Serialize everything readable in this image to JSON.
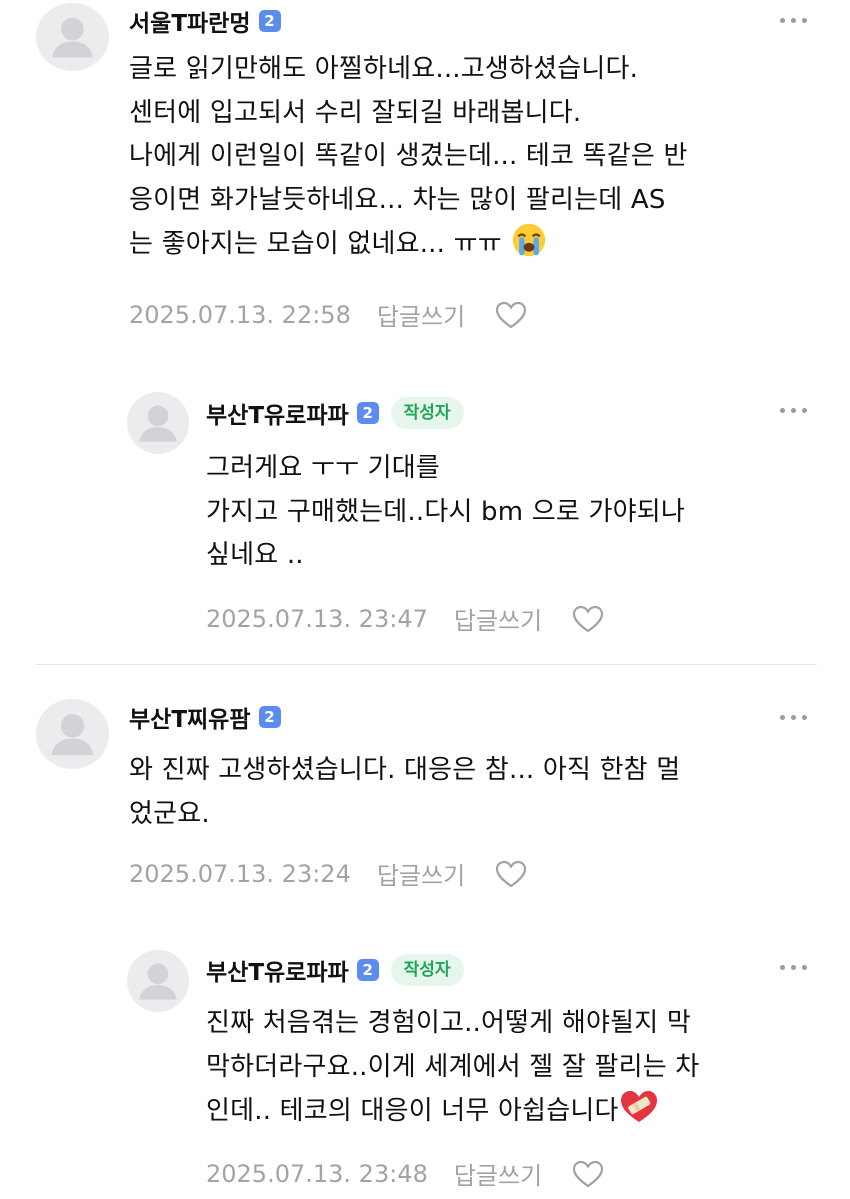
{
  "comments": [
    {
      "author": "서울T파란멍",
      "level": "2",
      "lines": [
        "글로 읽기만해도 아찔하네요...고생하셨습니다.",
        "센터에 입고되서 수리 잘되길 바래봅니다.",
        "나에게 이런일이 똑같이 생겼는데... 테코 똑같은 반",
        "응이면 화가날듯하네요... 차는 많이 팔리는데 AS",
        "는 좋아지는 모습이 없네요... ㅠㅠ "
      ],
      "emoji": "loudly-crying-face-emoji",
      "timestamp": "2025.07.13. 22:58",
      "reply_label": "답글쓰기"
    },
    {
      "author": "부산T유로파파",
      "level": "2",
      "badge": "작성자",
      "lines": [
        "그러게요 ㅜㅜ 기대를",
        "가지고 구매했는데..다시 bm 으로 가야되나",
        "싶네요 .."
      ],
      "timestamp": "2025.07.13. 23:47",
      "reply_label": "답글쓰기"
    },
    {
      "author": "부산T찌유팜",
      "level": "2",
      "lines": [
        "와 진짜 고생하셨습니다. 대응은 참... 아직 한참 멀",
        "었군요."
      ],
      "timestamp": "2025.07.13. 23:24",
      "reply_label": "답글쓰기"
    },
    {
      "author": "부산T유로파파",
      "level": "2",
      "badge": "작성자",
      "lines": [
        "진짜 처음겪는 경험이고..어떻게 해야될지 막",
        "막하더라구요..이게 세계에서 젤 잘 팔리는 차",
        "인데.. 테코의 대응이 너무 아쉽습니다"
      ],
      "emoji": "mending-heart-emoji",
      "timestamp": "2025.07.13. 23:48",
      "reply_label": "답글쓰기"
    }
  ],
  "icons": {
    "avatar": "default-avatar-icon",
    "more": "more-options-icon",
    "like": "heart-outline-icon"
  },
  "colors": {
    "level_badge": "#5b8def",
    "writer_badge_bg": "#e6f6ec",
    "writer_badge_text": "#1fa65a",
    "meta_text": "#a3a3a3"
  }
}
